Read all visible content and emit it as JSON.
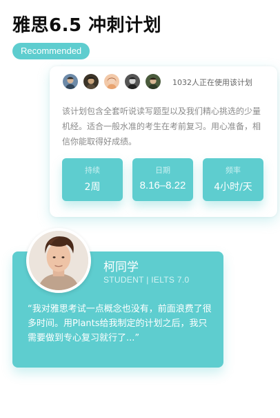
{
  "page": {
    "title": "雅思6.5 冲刺计划",
    "badge": "Recommended"
  },
  "plan": {
    "avatars": [
      "user-avatar-1",
      "user-avatar-2",
      "user-avatar-3",
      "user-avatar-4",
      "user-avatar-5"
    ],
    "users_text": "1032人正在使用该计划",
    "description": "该计划包含全套听说读写题型以及我们精心挑选的少量机经。适合一般水准的考生在考前复习。用心准备，相信你能取得好成绩。",
    "stats": [
      {
        "label": "持续",
        "value": "2周"
      },
      {
        "label": "日期",
        "value": "8.16–8.22"
      },
      {
        "label": "频率",
        "value": "4小时/天"
      }
    ]
  },
  "review": {
    "name": "柯同学",
    "role": "STUDENT ",
    "score": "IELTS 7.0",
    "quote": "“我对雅思考试一点概念也没有，前面浪费了很多时间。用Plants给我制定的计划之后，我只需要做到专心复习就行了...”"
  },
  "colors": {
    "accent": "#5ecdcf",
    "title": "#0e0e0e",
    "muted_text": "#8a8a8a",
    "card_bg": "#ffffff"
  }
}
